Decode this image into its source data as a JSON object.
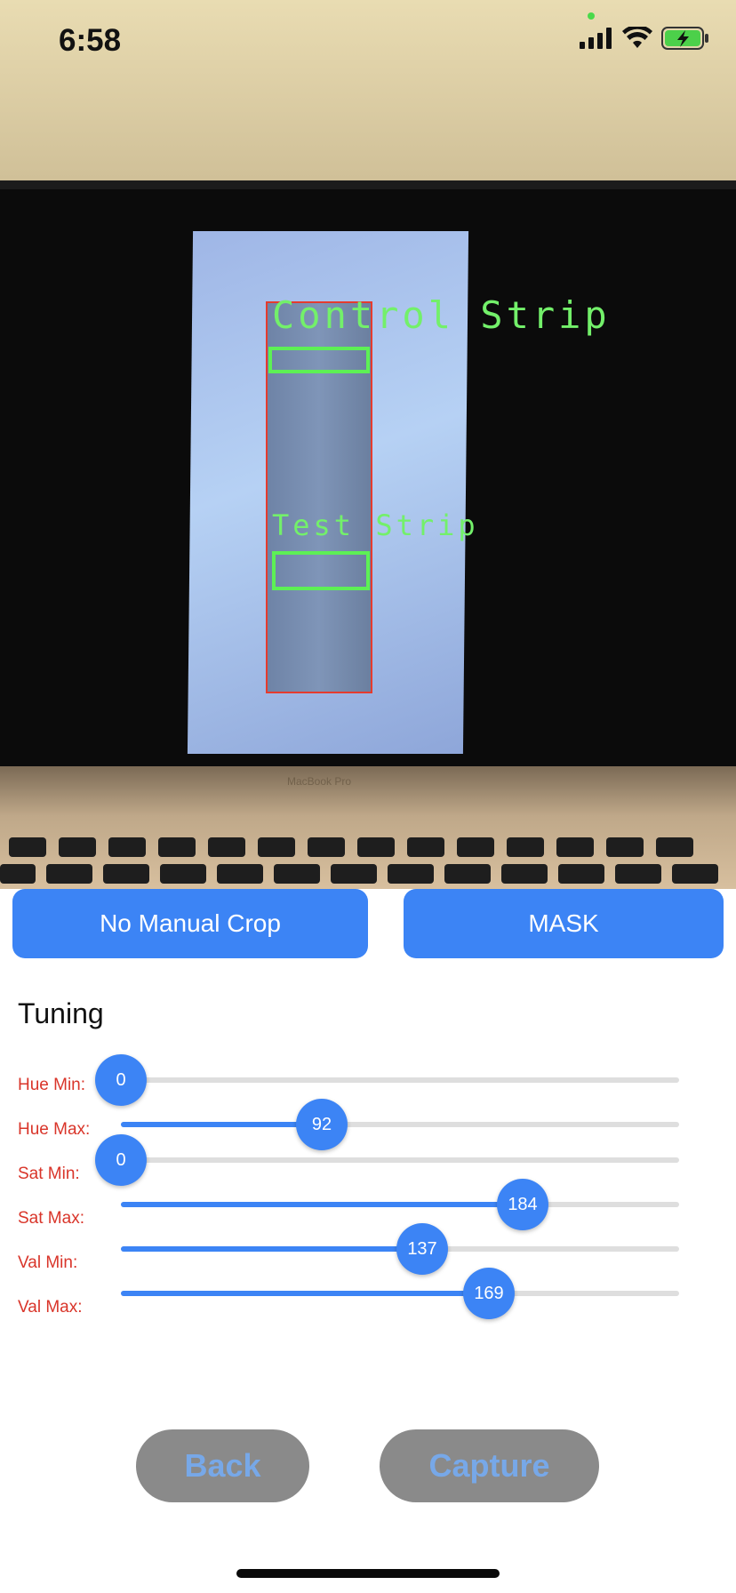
{
  "status": {
    "time": "6:58",
    "icons": [
      "signal-icon",
      "wifi-icon",
      "battery-charging-icon"
    ]
  },
  "camera": {
    "overlay": {
      "control_label": "Control Strip",
      "test_label": "Test Strip",
      "box_color": "#5df055",
      "roi_color": "#e53b2e"
    },
    "device_label": "MacBook Pro"
  },
  "actions": {
    "crop_label": "No Manual Crop",
    "mask_label": "MASK"
  },
  "tuning": {
    "title": "Tuning",
    "sliders": [
      {
        "label": "Hue Min:",
        "value": "0",
        "fraction": 0.0
      },
      {
        "label": "Hue Max:",
        "value": "92",
        "fraction": 0.36
      },
      {
        "label": "Sat Min:",
        "value": "0",
        "fraction": 0.0
      },
      {
        "label": "Sat Max:",
        "value": "184",
        "fraction": 0.72
      },
      {
        "label": "Val Min:",
        "value": "137",
        "fraction": 0.54
      },
      {
        "label": "Val Max:",
        "value": "169",
        "fraction": 0.66
      }
    ]
  },
  "footer": {
    "back_label": "Back",
    "capture_label": "Capture"
  },
  "colors": {
    "accent": "#3c84f5",
    "label_red": "#d9352a",
    "disabled_button": "#8a8a8a",
    "disabled_text": "#77a8e8"
  }
}
